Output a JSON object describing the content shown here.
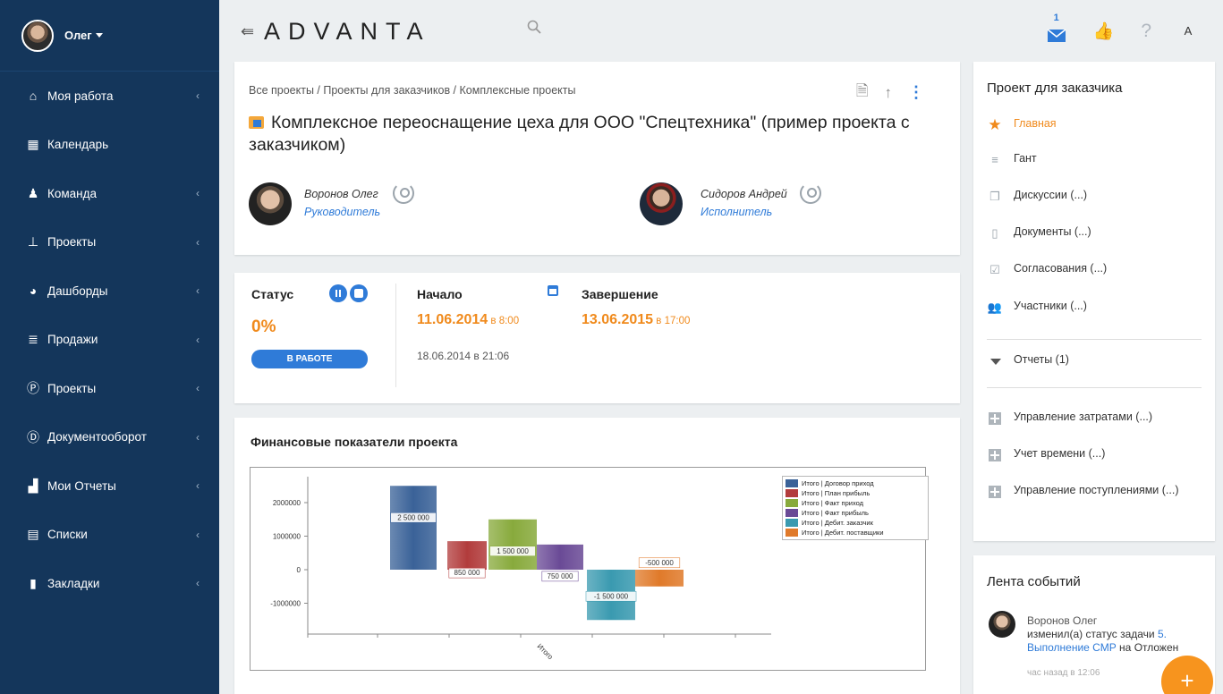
{
  "user": {
    "name": "Олег"
  },
  "sidebar": {
    "items": [
      {
        "label": "Моя работа",
        "icon": "home-icon",
        "glyph": "⌂",
        "has_chevron": true
      },
      {
        "label": "Календарь",
        "icon": "calendar-icon",
        "glyph": "▦",
        "has_chevron": false
      },
      {
        "label": "Команда",
        "icon": "team-icon",
        "glyph": "♟",
        "has_chevron": true
      },
      {
        "label": "Проекты",
        "icon": "hierarchy-icon",
        "glyph": "⊥",
        "has_chevron": true
      },
      {
        "label": "Дашборды",
        "icon": "pie-chart-icon",
        "glyph": "◕",
        "has_chevron": true
      },
      {
        "label": "Продажи",
        "icon": "sales-icon",
        "glyph": "≣",
        "has_chevron": true
      },
      {
        "label": "Проекты",
        "icon": "circle-p-icon",
        "glyph": "Ⓟ",
        "has_chevron": true
      },
      {
        "label": "Документооборот",
        "icon": "circle-d-icon",
        "glyph": "Ⓓ",
        "has_chevron": true
      },
      {
        "label": "Мои Отчеты",
        "icon": "reports-icon",
        "glyph": "▟",
        "has_chevron": true
      },
      {
        "label": "Списки",
        "icon": "list-icon",
        "glyph": "▤",
        "has_chevron": true
      },
      {
        "label": "Закладки",
        "icon": "bookmark-icon",
        "glyph": "▮",
        "has_chevron": true
      }
    ]
  },
  "topbar": {
    "logo": "ADVANTA",
    "mail_count": "1"
  },
  "project": {
    "breadcrumb": "Все проекты / Проекты для заказчиков / Комплексные проекты",
    "title": "Комплексное переоснащение цеха для ООО \"Спецтехника\" (пример проекта с заказчиком)",
    "manager_name": "Воронов Олег",
    "manager_role": "Руководитель",
    "executor_name": "Сидоров Андрей",
    "executor_role": "Исполнитель"
  },
  "status": {
    "label": "Статус",
    "percent": "0%",
    "badge": "В РАБОТЕ",
    "start_label": "Начало",
    "start_date": "11.06.2014",
    "start_time": " в 8:00",
    "end_label": "Завершение",
    "end_date": "13.06.2015",
    "end_time": " в 17:00",
    "created": "18.06.2014 в 21:06"
  },
  "finance": {
    "title": "Финансовые показатели проекта"
  },
  "chart_data": {
    "type": "bar",
    "categories": [
      "Итого"
    ],
    "series": [
      {
        "name": "Итого | Договор приход",
        "values": [
          2500000
        ],
        "label": "2 500 000",
        "color": "#3a6298"
      },
      {
        "name": "Итого | План прибыль",
        "values": [
          850000
        ],
        "label": "850 000",
        "color": "#b23c3c"
      },
      {
        "name": "Итого | Факт приход",
        "values": [
          1500000
        ],
        "label": "1 500 000",
        "color": "#88aa3c"
      },
      {
        "name": "Итого | Факт прибыль",
        "values": [
          750000
        ],
        "label": "750 000",
        "color": "#6a4a96"
      },
      {
        "name": "Итого | Дебит. заказчик",
        "values": [
          -1500000
        ],
        "label": "-1 500 000",
        "color": "#3a9ab0"
      },
      {
        "name": "Итого | Дебит. поставщики",
        "values": [
          -500000
        ],
        "label": "-500 000",
        "color": "#e07a2a"
      }
    ],
    "y_ticks": [
      "2000000",
      "1000000",
      "0",
      "-1000000"
    ],
    "ylim": [
      -1500000,
      2500000
    ],
    "legend": "right"
  },
  "right_panel": {
    "title": "Проект для заказчика",
    "items": [
      {
        "label": "Главная",
        "icon": "star-icon"
      },
      {
        "label": "Гант",
        "icon": "gantt-icon"
      },
      {
        "label": "Дискуссии (...)",
        "icon": "discussion-icon"
      },
      {
        "label": "Документы (...)",
        "icon": "document-icon"
      },
      {
        "label": "Согласования (...)",
        "icon": "approval-icon"
      },
      {
        "label": "Участники (...)",
        "icon": "participants-icon"
      }
    ],
    "reports": "Отчеты (1)",
    "extras": [
      {
        "label": "Управление затратами (...)"
      },
      {
        "label": "Учет времени (...)"
      },
      {
        "label": "Управление поступлениями (...)"
      }
    ]
  },
  "feed": {
    "title": "Лента событий",
    "author": "Воронов Олег",
    "text_1": "изменил(а) статус ",
    "text_task": "задачи",
    "text_link": " 5. Выполнение СМР",
    "text_2": " на ",
    "text_status": "Отложен",
    "time": "час назад в 12:06"
  },
  "fab": {
    "label": "+"
  }
}
